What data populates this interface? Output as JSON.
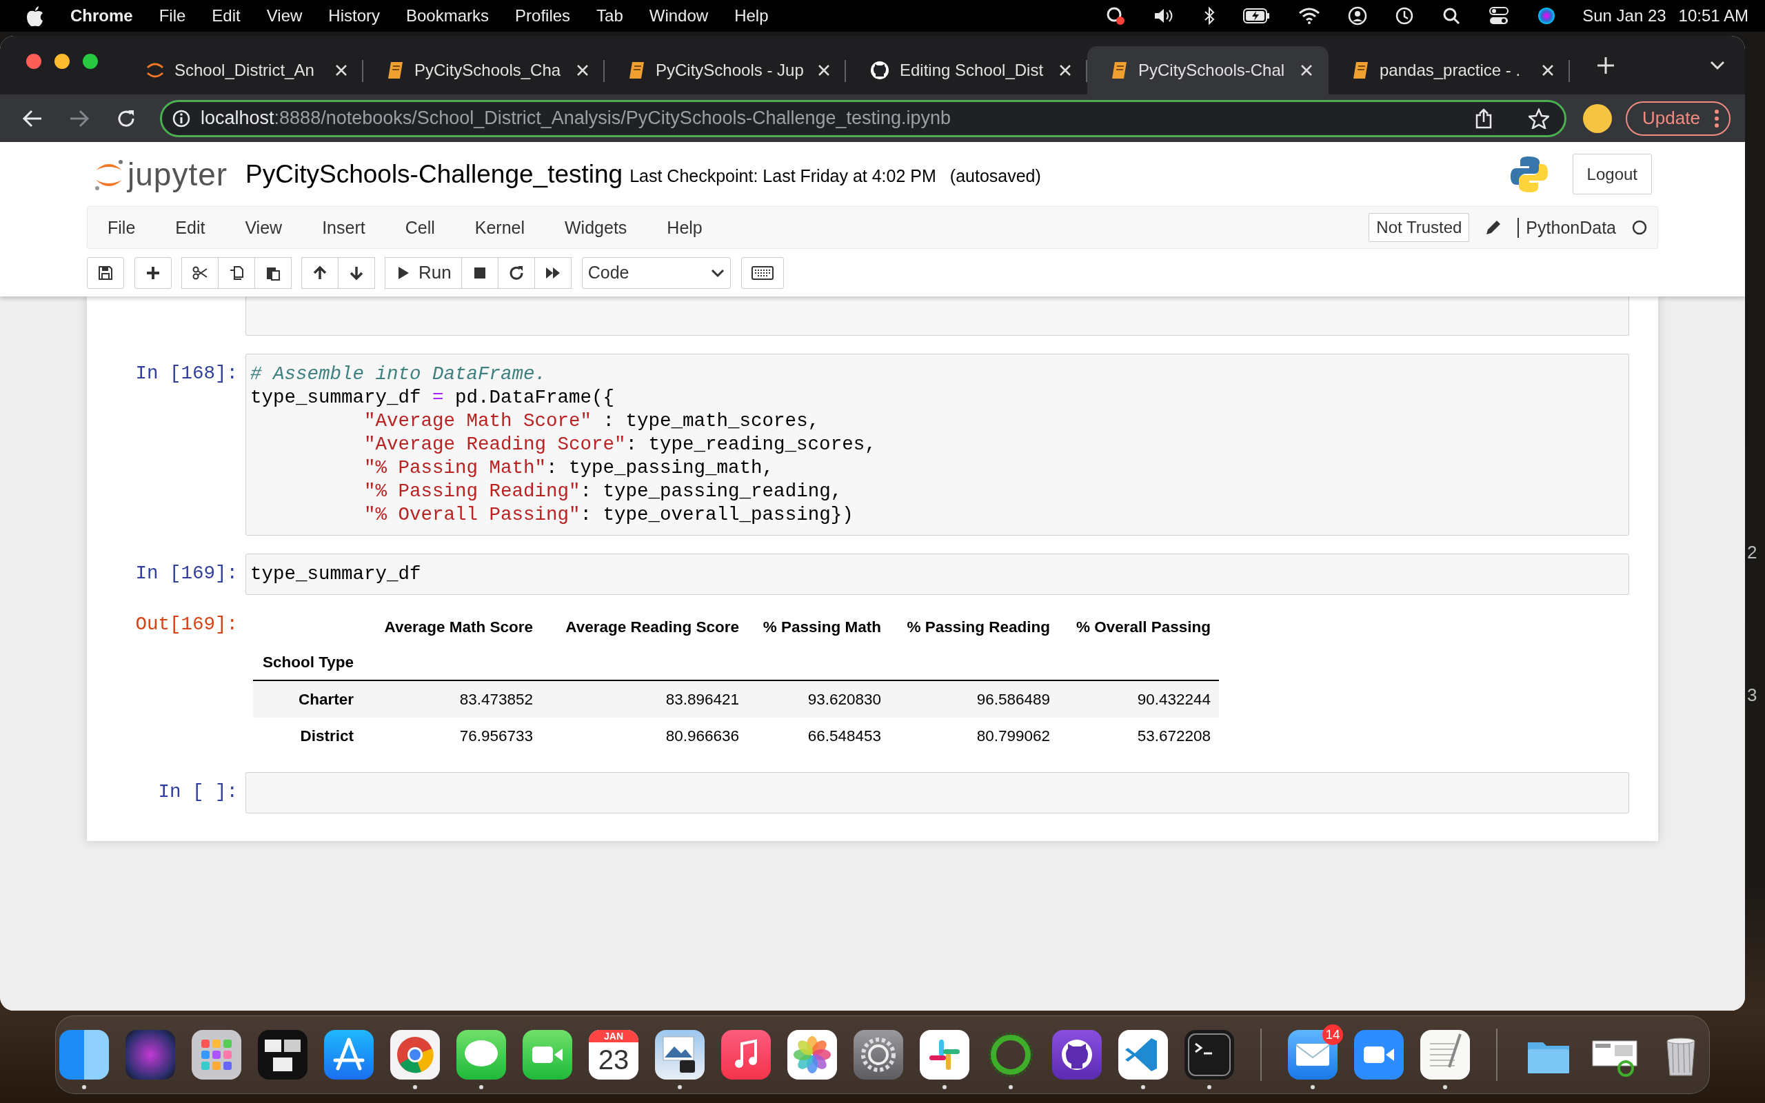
{
  "menu_bar": {
    "app": "Chrome",
    "items": [
      "File",
      "Edit",
      "View",
      "History",
      "Bookmarks",
      "Profiles",
      "Tab",
      "Window",
      "Help"
    ],
    "date": "Sun Jan 23",
    "time": "10:51 AM"
  },
  "browser": {
    "tabs": [
      {
        "title": "School_District_An",
        "kind": "jupyter",
        "selected": false
      },
      {
        "title": "PyCitySchools_Cha",
        "kind": "notebook",
        "selected": false
      },
      {
        "title": "PyCitySchools - Jup",
        "kind": "notebook",
        "selected": false
      },
      {
        "title": "Editing School_Dist",
        "kind": "github",
        "selected": false
      },
      {
        "title": "PyCitySchools-Chal",
        "kind": "notebook",
        "selected": true
      },
      {
        "title": "pandas_practice - .",
        "kind": "notebook",
        "selected": false
      }
    ],
    "address": {
      "host": "localhost",
      "path": ":8888/notebooks/School_District_Analysis/PyCitySchools-Challenge_testing.ipynb"
    },
    "update_button": "Update"
  },
  "jupyter": {
    "logo_text": "jupyter",
    "notebook_title": "PyCitySchools-Challenge_testing",
    "checkpoint": "Last Checkpoint: Last Friday at 4:02 PM",
    "autosave": "(autosaved)",
    "logout": "Logout",
    "menu": [
      "File",
      "Edit",
      "View",
      "Insert",
      "Cell",
      "Kernel",
      "Widgets",
      "Help"
    ],
    "trust": "Not Trusted",
    "kernel": "PythonData",
    "run_label": "Run",
    "cell_type": "Code"
  },
  "cells": [
    {
      "kind": "partial"
    },
    {
      "kind": "code",
      "prompt": "In [168]:",
      "lines": [
        {
          "indented": false,
          "tokens": [
            {
              "kind": "comment",
              "s": "# Assemble into DataFrame."
            }
          ]
        },
        {
          "indented": false,
          "tokens": [
            {
              "kind": "plain",
              "s": "type_summary_df "
            },
            {
              "kind": "op",
              "s": "="
            },
            {
              "kind": "plain",
              "s": " pd.DataFrame({"
            }
          ]
        },
        {
          "indented": true,
          "tokens": [
            {
              "kind": "string",
              "s": "\"Average Math Score\""
            },
            {
              "kind": "plain",
              "s": " : type_math_scores,"
            }
          ]
        },
        {
          "indented": true,
          "tokens": [
            {
              "kind": "string",
              "s": "\"Average Reading Score\""
            },
            {
              "kind": "plain",
              "s": ": type_reading_scores,"
            }
          ]
        },
        {
          "indented": true,
          "tokens": [
            {
              "kind": "string",
              "s": "\"% Passing Math\""
            },
            {
              "kind": "plain",
              "s": ": type_passing_math,"
            }
          ]
        },
        {
          "indented": true,
          "tokens": [
            {
              "kind": "string",
              "s": "\"% Passing Reading\""
            },
            {
              "kind": "plain",
              "s": ": type_passing_reading,"
            }
          ]
        },
        {
          "indented": true,
          "tokens": [
            {
              "kind": "string",
              "s": "\"% Overall Passing\""
            },
            {
              "kind": "plain",
              "s": ": type_overall_passing})"
            }
          ]
        }
      ]
    },
    {
      "kind": "code",
      "prompt": "In [169]:",
      "lines": [
        {
          "indented": false,
          "tokens": [
            {
              "kind": "plain",
              "s": "type_summary_df"
            }
          ]
        }
      ]
    },
    {
      "kind": "output",
      "prompt": "Out[169]:",
      "table": {
        "columns": [
          "Average Math Score",
          "Average Reading Score",
          "% Passing Math",
          "% Passing Reading",
          "% Overall Passing"
        ],
        "index_name": "School Type",
        "rows": [
          {
            "index": "Charter",
            "values": [
              "83.473852",
              "83.896421",
              "93.620830",
              "96.586489",
              "90.432244"
            ]
          },
          {
            "index": "District",
            "values": [
              "76.956733",
              "80.966636",
              "66.548453",
              "80.799062",
              "53.672208"
            ]
          }
        ]
      }
    },
    {
      "kind": "code",
      "prompt": "In [ ]:"
    }
  ],
  "background_window": {
    "lines": [
      "2",
      "3"
    ]
  },
  "dock": [
    {
      "kind": "finder",
      "running": true
    },
    {
      "kind": "siri",
      "running": false
    },
    {
      "kind": "launchpad",
      "running": false
    },
    {
      "kind": "mission",
      "running": false
    },
    {
      "kind": "appstore",
      "running": false
    },
    {
      "kind": "chrome",
      "running": true
    },
    {
      "kind": "messages",
      "running": true
    },
    {
      "kind": "facetime",
      "running": false
    },
    {
      "kind": "calendar",
      "month": "JAN",
      "day": "23",
      "running": false
    },
    {
      "kind": "preview",
      "running": true
    },
    {
      "kind": "music",
      "running": false
    },
    {
      "kind": "photos",
      "running": false
    },
    {
      "kind": "settings",
      "running": false
    },
    {
      "kind": "slack",
      "running": true
    },
    {
      "kind": "ring",
      "running": true
    },
    {
      "kind": "github",
      "running": false
    },
    {
      "kind": "vscode",
      "running": true
    },
    {
      "kind": "terminal",
      "running": true
    },
    {
      "kind": "separator"
    },
    {
      "kind": "mail",
      "badge": "14",
      "running": true
    },
    {
      "kind": "zoom",
      "running": false
    },
    {
      "kind": "textedit",
      "running": true
    },
    {
      "kind": "separator"
    },
    {
      "kind": "folder",
      "running": false
    },
    {
      "kind": "screenshot",
      "running": false
    },
    {
      "kind": "trash",
      "running": false
    }
  ]
}
